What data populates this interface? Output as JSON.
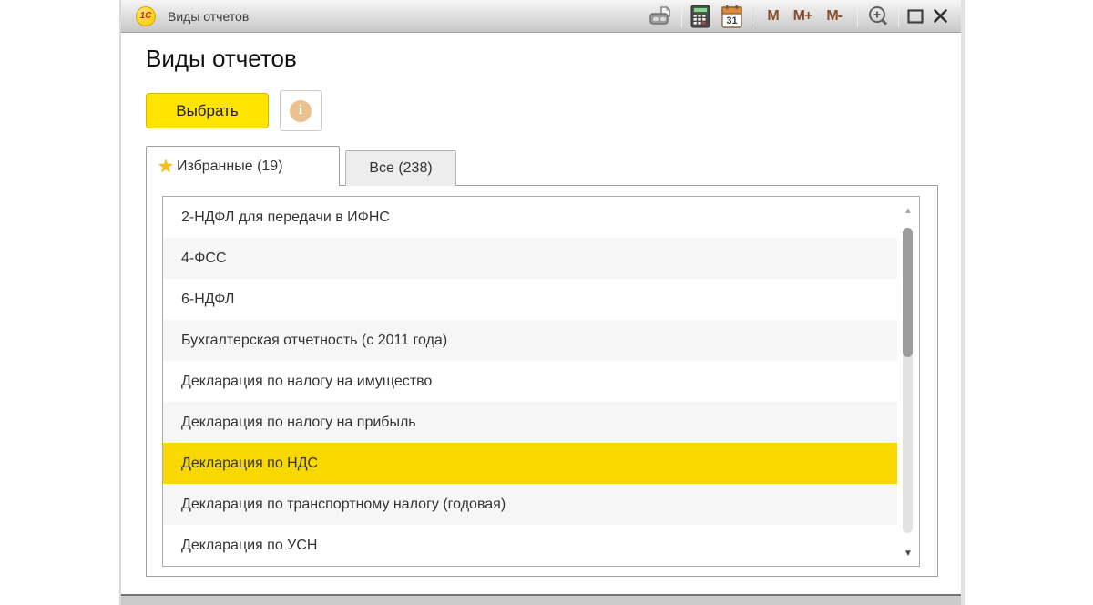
{
  "window": {
    "title": "Виды отчетов",
    "toolbar": {
      "icons": [
        "printer-icon",
        "calculator-icon",
        "calendar-icon",
        "zoom-in-icon",
        "maximize-icon",
        "close-icon"
      ],
      "calendar_day": "31",
      "memory_buttons": [
        "M",
        "M+",
        "M-"
      ]
    }
  },
  "main": {
    "heading": "Виды отчетов",
    "select_button_label": "Выбрать",
    "info_glyph": "i",
    "tabs": [
      {
        "label": "Избранные (19)",
        "active": true,
        "icon": "star",
        "star_glyph": "★"
      },
      {
        "label": "Все (238)",
        "active": false
      }
    ],
    "list": {
      "items": [
        {
          "label": "2-НДФЛ для передачи в ИФНС",
          "selected": false
        },
        {
          "label": "4-ФСС",
          "selected": false
        },
        {
          "label": "6-НДФЛ",
          "selected": false
        },
        {
          "label": "Бухгалтерская отчетность (с 2011 года)",
          "selected": false
        },
        {
          "label": "Декларация по налогу на имущество",
          "selected": false
        },
        {
          "label": "Декларация по налогу на прибыль",
          "selected": false
        },
        {
          "label": "Декларация по НДС",
          "selected": true
        },
        {
          "label": "Декларация по транспортному налогу (годовая)",
          "selected": false
        },
        {
          "label": "Декларация по УСН",
          "selected": false
        }
      ]
    }
  },
  "colors": {
    "accent_yellow": "#ffe400",
    "selected_row": "#f8d800",
    "titlebar_gradient_top": "#f6f6f6",
    "titlebar_gradient_bottom": "#c7c7c7",
    "memory_button_text": "#8a4b28",
    "row_alt": "#f6f6f6",
    "star": "#f2c011"
  }
}
